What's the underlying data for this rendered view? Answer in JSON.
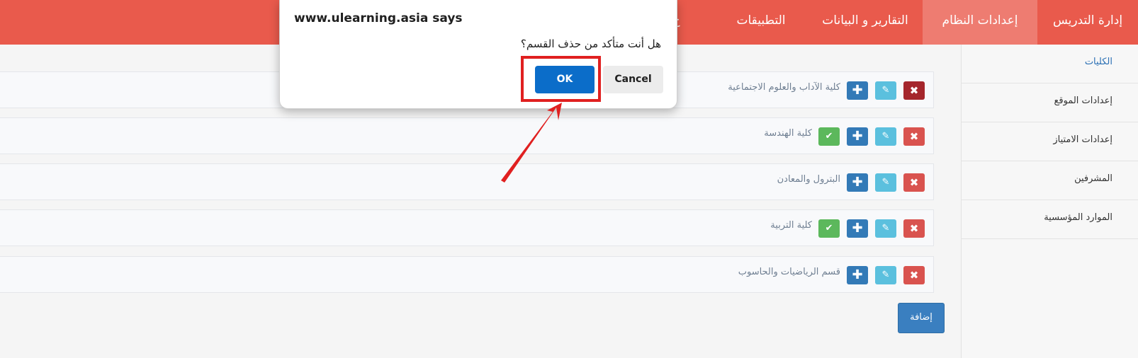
{
  "navbar": {
    "items": [
      "إدارة التدريس",
      "إعدادات النظام",
      "التقارير و البيانات",
      "التطبيقات",
      "ح"
    ],
    "active_index": 1
  },
  "sidebar": {
    "items": [
      "الكليات",
      "إعدادات الموقع",
      "إعدادات الامتياز",
      "المشرفين",
      "الموارد المؤسسية"
    ],
    "active_index": 0
  },
  "rows": [
    {
      "label": "كلية الآداب والعلوم الاجتماعية",
      "has_check": false
    },
    {
      "label": "كلية الهندسة",
      "has_check": true
    },
    {
      "label": "البترول والمعادن",
      "has_check": false
    },
    {
      "label": "كلية التربية",
      "has_check": true
    },
    {
      "label": "قسم الرياضيات والحاسوب",
      "has_check": false
    }
  ],
  "icons": {
    "delete": "✖",
    "edit": "✎",
    "add": "✚",
    "check": "✔"
  },
  "add_button": "إضافة",
  "dialog": {
    "title": "www.ulearning.asia says",
    "message": "هل أنت متأكد من حذف القسم؟",
    "ok": "OK",
    "cancel": "Cancel"
  },
  "colors": {
    "navbar": "#e95a4c",
    "ok": "#0b6dc9",
    "annotation": "#e02020"
  }
}
